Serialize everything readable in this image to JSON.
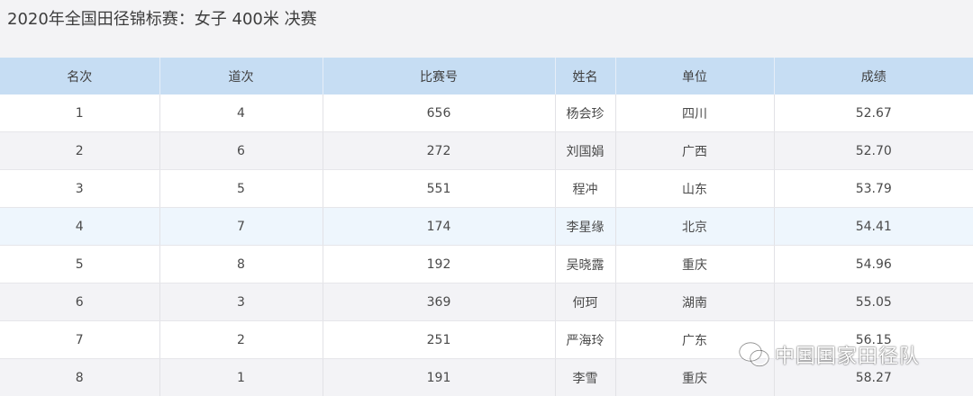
{
  "title": "2020年全国田径锦标赛：女子 400米 决赛",
  "table": {
    "headers": [
      "名次",
      "道次",
      "比赛号",
      "姓名",
      "单位",
      "成绩"
    ],
    "rows": [
      [
        "1",
        "4",
        "656",
        "杨会珍",
        "四川",
        "52.67"
      ],
      [
        "2",
        "6",
        "272",
        "刘国娟",
        "广西",
        "52.70"
      ],
      [
        "3",
        "5",
        "551",
        "程冲",
        "山东",
        "53.79"
      ],
      [
        "4",
        "7",
        "174",
        "李星缘",
        "北京",
        "54.41"
      ],
      [
        "5",
        "8",
        "192",
        "吴晓露",
        "重庆",
        "54.96"
      ],
      [
        "6",
        "3",
        "369",
        "何珂",
        "湖南",
        "55.05"
      ],
      [
        "7",
        "2",
        "251",
        "严海玲",
        "广东",
        "56.15"
      ],
      [
        "8",
        "1",
        "191",
        "李雪",
        "重庆",
        "58.27"
      ]
    ],
    "highlighted_row": 3
  },
  "watermark": {
    "icon": "wechat-icon",
    "text": "中国国家田径队"
  },
  "colors": {
    "header_bg": "#c6ddf3",
    "highlight_row_bg": "#eef6fd",
    "even_row_bg": "#f3f3f6",
    "page_bg": "#f3f3f5"
  }
}
